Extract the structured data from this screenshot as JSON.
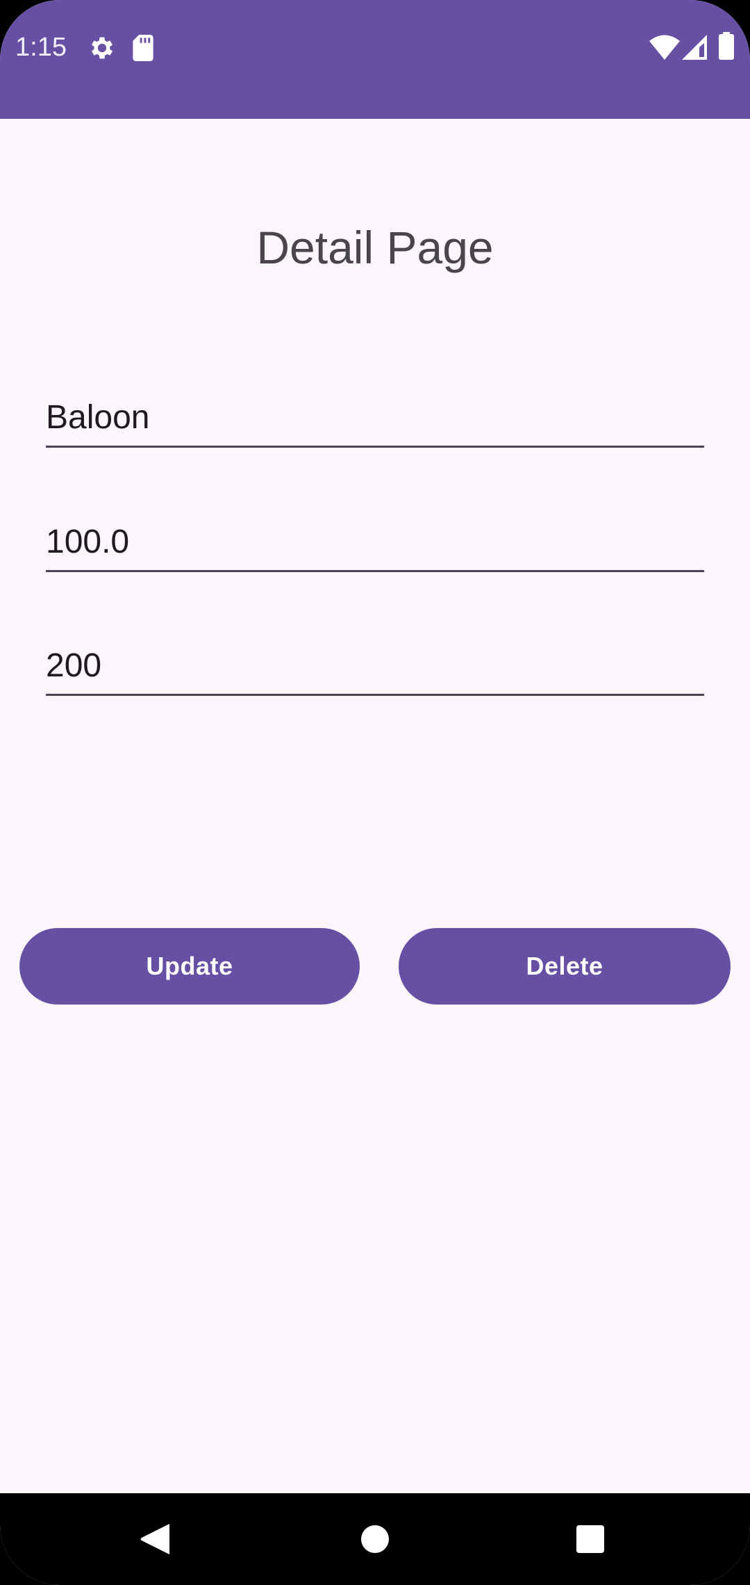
{
  "status_bar": {
    "time": "1:15",
    "icons": [
      "gear-icon",
      "sd-card-icon",
      "wifi-icon",
      "signal-icon",
      "battery-icon"
    ],
    "color": "#6750A4"
  },
  "page": {
    "title": "Detail Page"
  },
  "form": {
    "name_value": "Baloon",
    "price_value": "100.0",
    "quantity_value": "200"
  },
  "actions": {
    "update_label": "Update",
    "delete_label": "Delete"
  },
  "navigation": {
    "buttons": [
      "back-icon",
      "home-icon",
      "recents-icon"
    ]
  },
  "colors": {
    "primary": "#6750A4",
    "background": "#FCF6FC",
    "text": "#1D1B20"
  }
}
